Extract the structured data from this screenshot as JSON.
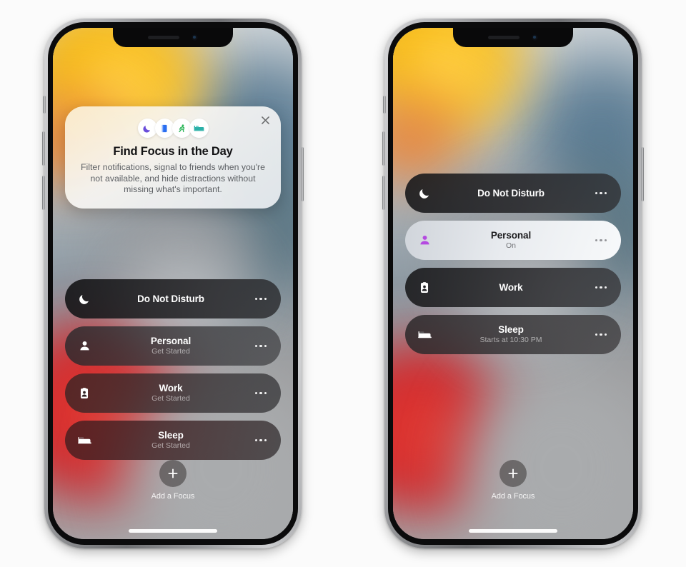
{
  "scene": {
    "background_color": "#fbfbfb",
    "device_count": 2,
    "device_name": "iPhone"
  },
  "onboarding_card": {
    "title": "Find Focus in the Day",
    "body": "Filter notifications, signal to friends when you're not available, and hide distractions without missing what's important.",
    "close_label": "✕",
    "icons": [
      {
        "name": "moon-icon",
        "glyph": "moon",
        "color": "#6a4ddb"
      },
      {
        "name": "book-icon",
        "glyph": "book",
        "color": "#2a6ef0"
      },
      {
        "name": "runner-icon",
        "glyph": "runner",
        "color": "#2bb558"
      },
      {
        "name": "bed-icon",
        "glyph": "bed",
        "color": "#2bb0a8"
      }
    ]
  },
  "left_phone": {
    "focus_modes": [
      {
        "name": "Do Not Disturb",
        "subtitle": "",
        "icon": "moon-icon",
        "state": "inactive",
        "more_label": "···"
      },
      {
        "name": "Personal",
        "subtitle": "Get Started",
        "icon": "person-icon",
        "state": "inactive",
        "more_label": "···"
      },
      {
        "name": "Work",
        "subtitle": "Get Started",
        "icon": "badge-icon",
        "state": "inactive",
        "more_label": "···"
      },
      {
        "name": "Sleep",
        "subtitle": "Get Started",
        "icon": "bed-icon",
        "state": "inactive",
        "more_label": "···"
      }
    ],
    "add_focus": {
      "label": "Add a Focus",
      "plus": "+"
    }
  },
  "right_phone": {
    "focus_modes": [
      {
        "name": "Do Not Disturb",
        "subtitle": "",
        "icon": "moon-icon",
        "state": "inactive",
        "more_label": "···"
      },
      {
        "name": "Personal",
        "subtitle": "On",
        "icon": "person-icon",
        "state": "active",
        "more_label": "···"
      },
      {
        "name": "Work",
        "subtitle": "",
        "icon": "badge-icon",
        "state": "inactive",
        "more_label": "···"
      },
      {
        "name": "Sleep",
        "subtitle": "Starts at 10:30 PM",
        "icon": "bed-icon",
        "state": "inactive",
        "more_label": "···"
      }
    ],
    "add_focus": {
      "label": "Add a Focus",
      "plus": "+"
    }
  },
  "colors": {
    "active_row_accent": "#b44ae0",
    "wallpaper_yellow": "#f5b100",
    "wallpaper_red": "#cb1f28",
    "wallpaper_blue": "#5f7f96",
    "wallpaper_grey": "#a9abad"
  }
}
